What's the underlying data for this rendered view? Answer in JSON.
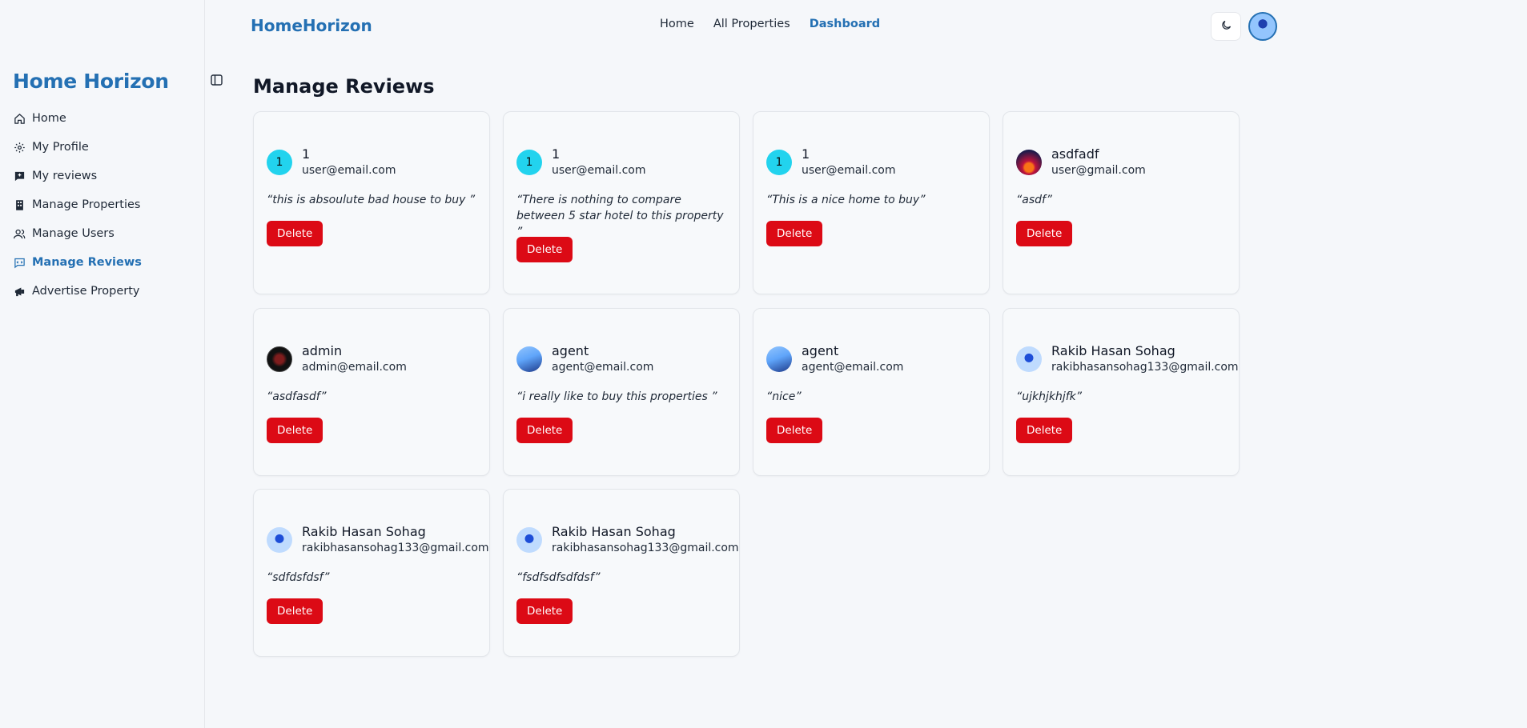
{
  "app": {
    "top_logo": "HomeHorizon",
    "sidebar_brand": "Home Horizon",
    "accent_color": "#2470b3",
    "danger_color": "#dc0a15"
  },
  "topnav": {
    "items": [
      {
        "label": "Home",
        "active": false
      },
      {
        "label": "All Properties",
        "active": false
      },
      {
        "label": "Dashboard",
        "active": true
      }
    ],
    "theme_icon": "moon-icon"
  },
  "sidebar": {
    "items": [
      {
        "label": "Home",
        "icon": "house-icon",
        "active": false
      },
      {
        "label": "My Profile",
        "icon": "gear-icon",
        "active": false
      },
      {
        "label": "My reviews",
        "icon": "message-icon",
        "active": false
      },
      {
        "label": "Manage Properties",
        "icon": "building-icon",
        "active": false
      },
      {
        "label": "Manage Users",
        "icon": "users-icon",
        "active": false
      },
      {
        "label": "Manage Reviews",
        "icon": "review-icon",
        "active": true
      },
      {
        "label": "Advertise Property",
        "icon": "megaphone-icon",
        "active": false
      }
    ]
  },
  "page": {
    "title": "Manage Reviews"
  },
  "reviews": [
    {
      "avatar": "1",
      "avatar_style": "cyan",
      "name": "1",
      "email": "user@email.com",
      "text": "“this is absoulute bad house to buy ”",
      "button": "Delete"
    },
    {
      "avatar": "1",
      "avatar_style": "cyan",
      "name": "1",
      "email": "user@email.com",
      "text": "“There is nothing to compare between 5 star hotel to this property ”",
      "button": "Delete"
    },
    {
      "avatar": "1",
      "avatar_style": "cyan",
      "name": "1",
      "email": "user@email.com",
      "text": "“This is a nice home to buy”",
      "button": "Delete"
    },
    {
      "avatar": "",
      "avatar_style": "sunset",
      "name": "asdfadf",
      "email": "user@gmail.com",
      "text": "“asdf”",
      "button": "Delete"
    },
    {
      "avatar": "",
      "avatar_style": "dark",
      "name": "admin",
      "email": "admin@email.com",
      "text": "“asdfasdf”",
      "button": "Delete"
    },
    {
      "avatar": "",
      "avatar_style": "photo",
      "name": "agent",
      "email": "agent@email.com",
      "text": "“i really like to buy this properties ”",
      "button": "Delete"
    },
    {
      "avatar": "",
      "avatar_style": "photo",
      "name": "agent",
      "email": "agent@email.com",
      "text": "“nice”",
      "button": "Delete"
    },
    {
      "avatar": "",
      "avatar_style": "blue",
      "name": "Rakib Hasan Sohag",
      "email": "rakibhasansohag133@gmail.com",
      "text": "“ujkhjkhjfk”",
      "button": "Delete"
    },
    {
      "avatar": "",
      "avatar_style": "blue",
      "name": "Rakib Hasan Sohag",
      "email": "rakibhasansohag133@gmail.com",
      "text": "“sdfdsfdsf”",
      "button": "Delete"
    },
    {
      "avatar": "",
      "avatar_style": "blue",
      "name": "Rakib Hasan Sohag",
      "email": "rakibhasansohag133@gmail.com",
      "text": "“fsdfsdfsdfdsf”",
      "button": "Delete"
    }
  ]
}
